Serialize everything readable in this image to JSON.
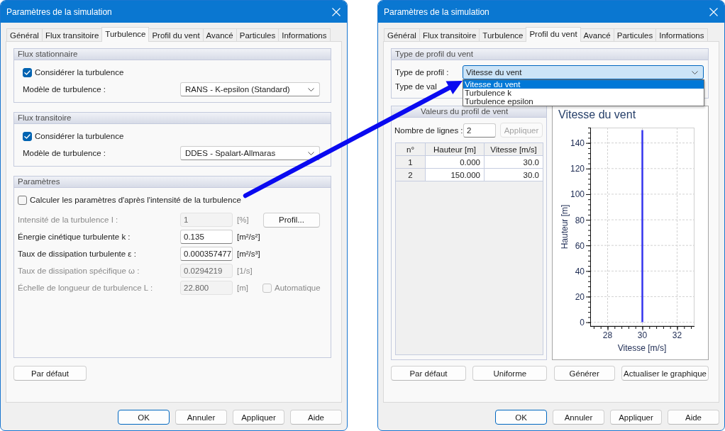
{
  "left_dialog": {
    "title": "Paramètres de la simulation",
    "tabs": [
      {
        "label": "Général",
        "selected": false
      },
      {
        "label": "Flux transitoire",
        "selected": false
      },
      {
        "label": "Turbulence",
        "selected": true
      },
      {
        "label": "Profil du vent",
        "selected": false
      },
      {
        "label": "Avancé",
        "selected": false
      },
      {
        "label": "Particules",
        "selected": false
      },
      {
        "label": "Informations",
        "selected": false
      }
    ],
    "flow_groups": [
      {
        "title": "Flux stationnaire",
        "checkbox": {
          "label": "Considérer la turbulence",
          "checked": true
        },
        "model": {
          "label": "Modèle de turbulence :",
          "value": "RANS - K-epsilon (Standard)"
        }
      },
      {
        "title": "Flux transitoire",
        "checkbox": {
          "label": "Considérer la turbulence",
          "checked": true
        },
        "model": {
          "label": "Modèle de turbulence :",
          "value": "DDES - Spalart-Allmaras"
        }
      }
    ],
    "parameters": {
      "title": "Paramètres",
      "checkbox": {
        "label": "Calculer les paramètres d'après l'intensité de la turbulence",
        "checked": false
      },
      "rows": [
        {
          "label": "Intensité de la turbulence I :",
          "value": "1",
          "unit": "[%]",
          "disabled": true,
          "button": "Profil..."
        },
        {
          "label": "Énergie cinétique turbulente k :",
          "value": "0.135",
          "unit": "[m²/s²]",
          "disabled": false
        },
        {
          "label": "Taux de dissipation turbulente ε :",
          "value": "0.000357477",
          "unit": "[m²/s³]",
          "disabled": false
        },
        {
          "label": "Taux de dissipation spécifique ω :",
          "value": "0.0294219",
          "unit": "[1/s]",
          "disabled": true
        },
        {
          "label": "Échelle de longueur de turbulence L :",
          "value": "22.800",
          "unit": "[m]",
          "disabled": true,
          "checkbox": {
            "label": "Automatique",
            "checked": false,
            "disabled": true
          }
        }
      ]
    },
    "default_button": "Par défaut",
    "footer_buttons": [
      {
        "label": "OK",
        "default": true
      },
      {
        "label": "Annuler",
        "default": false
      },
      {
        "label": "Appliquer",
        "default": false
      },
      {
        "label": "Aide",
        "default": false
      }
    ]
  },
  "right_dialog": {
    "title": "Paramètres de la simulation",
    "tabs": [
      {
        "label": "Général",
        "selected": false
      },
      {
        "label": "Flux transitoire",
        "selected": false
      },
      {
        "label": "Turbulence",
        "selected": false
      },
      {
        "label": "Profil du vent",
        "selected": true
      },
      {
        "label": "Avancé",
        "selected": false
      },
      {
        "label": "Particules",
        "selected": false
      },
      {
        "label": "Informations",
        "selected": false
      }
    ],
    "profile_group": {
      "title": "Type de profil du vent",
      "profile_type": {
        "label": "Type de profil :",
        "value": "Vitesse du vent",
        "expanded": true,
        "options": [
          {
            "label": "Vitesse du vent",
            "selected": true
          },
          {
            "label": "Turbulence k",
            "selected": false
          },
          {
            "label": "Turbulence epsilon",
            "selected": false
          }
        ]
      },
      "value_type_label": "Type de val"
    },
    "values_group": {
      "title": "Valeurs du profil de vent",
      "row_count": {
        "label": "Nombre de lignes :",
        "value": "2"
      },
      "apply_button": {
        "label": "Appliquer",
        "disabled": true
      },
      "table": {
        "columns": [
          "n°",
          "Hauteur [m]",
          "Vitesse [m/s]"
        ],
        "rows": [
          [
            "1",
            "0.000",
            "30.0"
          ],
          [
            "2",
            "150.000",
            "30.0"
          ]
        ]
      }
    },
    "chart": {
      "chart_data": {
        "type": "line",
        "title": "Vitesse du vent",
        "xlabel": "Vitesse [m/s]",
        "ylabel": "Hauteur [m]",
        "x": [
          30,
          30
        ],
        "series": [
          {
            "color": "#3333ee",
            "values": [
              0,
              150
            ]
          }
        ],
        "xlim": [
          27,
          33
        ],
        "ylim": [
          -3,
          152
        ],
        "xticks": [
          28,
          30,
          32
        ],
        "yticks": [
          0,
          20,
          40,
          60,
          80,
          100,
          120,
          140
        ],
        "grid": true
      }
    },
    "action_buttons": [
      "Par défaut",
      "Uniforme",
      "Générer",
      "Actualiser le graphique"
    ],
    "footer_buttons": [
      {
        "label": "OK",
        "default": true
      },
      {
        "label": "Annuler",
        "default": false
      },
      {
        "label": "Appliquer",
        "default": false
      },
      {
        "label": "Aide",
        "default": false
      }
    ]
  }
}
